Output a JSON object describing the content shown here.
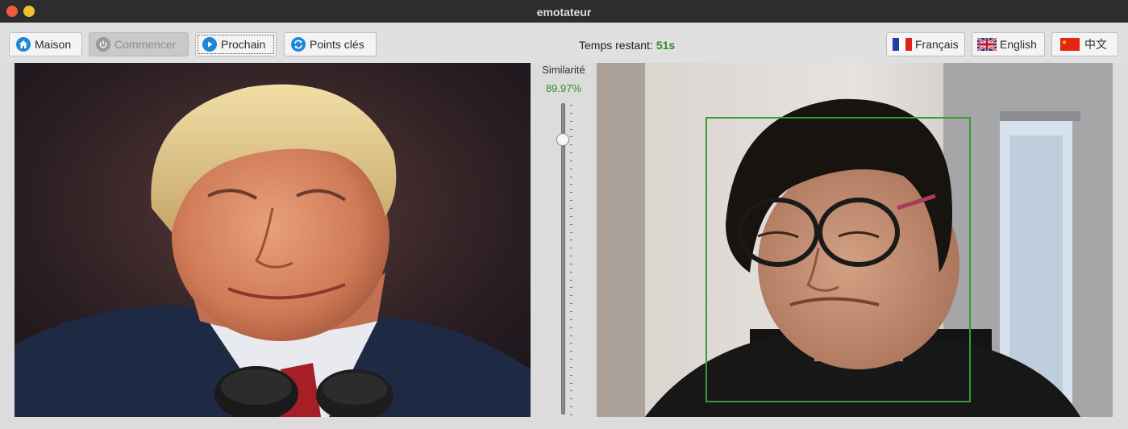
{
  "window": {
    "title": "emotateur"
  },
  "toolbar": {
    "home_label": "Maison",
    "start_label": "Commencer",
    "next_label": "Prochain",
    "keypoints_label": "Points clés",
    "timer_label": "Temps restant:",
    "timer_value": "51s",
    "lang_fr_label": "Français",
    "lang_en_label": "English",
    "lang_zh_label": "中文"
  },
  "similarity": {
    "label": "Similarité",
    "value": "89.97%",
    "slider_level": 0.9
  },
  "colors": {
    "accent": "#1e88d8",
    "similarity_green": "#2e8b2e",
    "face_box": "#3a9a35"
  },
  "icons": {
    "home": "home-icon",
    "start": "power-icon",
    "next": "play-icon",
    "keypoints": "refresh-icon"
  }
}
